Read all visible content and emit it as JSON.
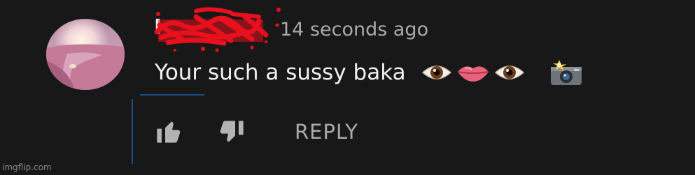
{
  "comment": {
    "author": "I",
    "timestamp": "14 seconds ago",
    "text": "Your such a sussy baka",
    "emojis": [
      "eye-emoji",
      "lips-emoji",
      "eye-emoji",
      "camera-flash-emoji"
    ]
  },
  "actions": {
    "like_icon": "thumbs-up-icon",
    "dislike_icon": "thumbs-down-icon",
    "reply_label": "REPLY"
  },
  "watermark": "imgflip.com",
  "colors": {
    "background": "#181818",
    "text_primary": "#f1f1f1",
    "text_secondary": "#aaaaaa",
    "scribble": "#e8101e",
    "focus_line": "#1c4e8a"
  }
}
